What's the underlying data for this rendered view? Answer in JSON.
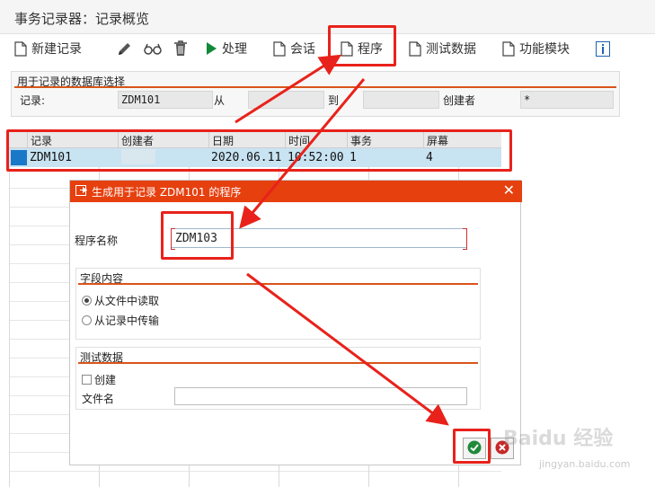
{
  "window": {
    "title": "事务记录器：记录概览"
  },
  "toolbar": {
    "new_record": "新建记录",
    "process": "处理",
    "session": "会话",
    "program": "程序",
    "test_data": "测试数据",
    "function_module": "功能模块"
  },
  "selection": {
    "heading": "用于记录的数据库选择",
    "record_label": "记录:",
    "record_value": "ZDM101",
    "from_label": "从",
    "from_value": "",
    "to_label": "到 .",
    "to_value": "",
    "creator_label": "创建者",
    "creator_value": "*"
  },
  "table": {
    "headers": [
      "记录",
      "创建者",
      "日期",
      "时间",
      "事务",
      "屏幕"
    ],
    "row": {
      "record": "ZDM101",
      "creator": "",
      "date": "2020.06.11",
      "time": "10:52:00",
      "transaction": "1",
      "screen": "4"
    }
  },
  "dialog": {
    "title": "生成用于记录 ZDM101 的程序",
    "program_name_label": "程序名称",
    "program_name_value": "ZDM103",
    "field_content": {
      "title": "字段内容",
      "options": [
        "从文件中读取",
        "从记录中传输"
      ],
      "selected": 0
    },
    "test_data": {
      "title": "测试数据",
      "create_label": "创建",
      "create_checked": false,
      "filename_label": "文件名",
      "filename_value": ""
    }
  },
  "watermark": {
    "brand": "Baidu 经验",
    "url": "jingyan.baidu.com"
  },
  "colors": {
    "accent": "#e6400f",
    "highlight": "#e8221b",
    "selected_row": "#c8e3f2"
  }
}
